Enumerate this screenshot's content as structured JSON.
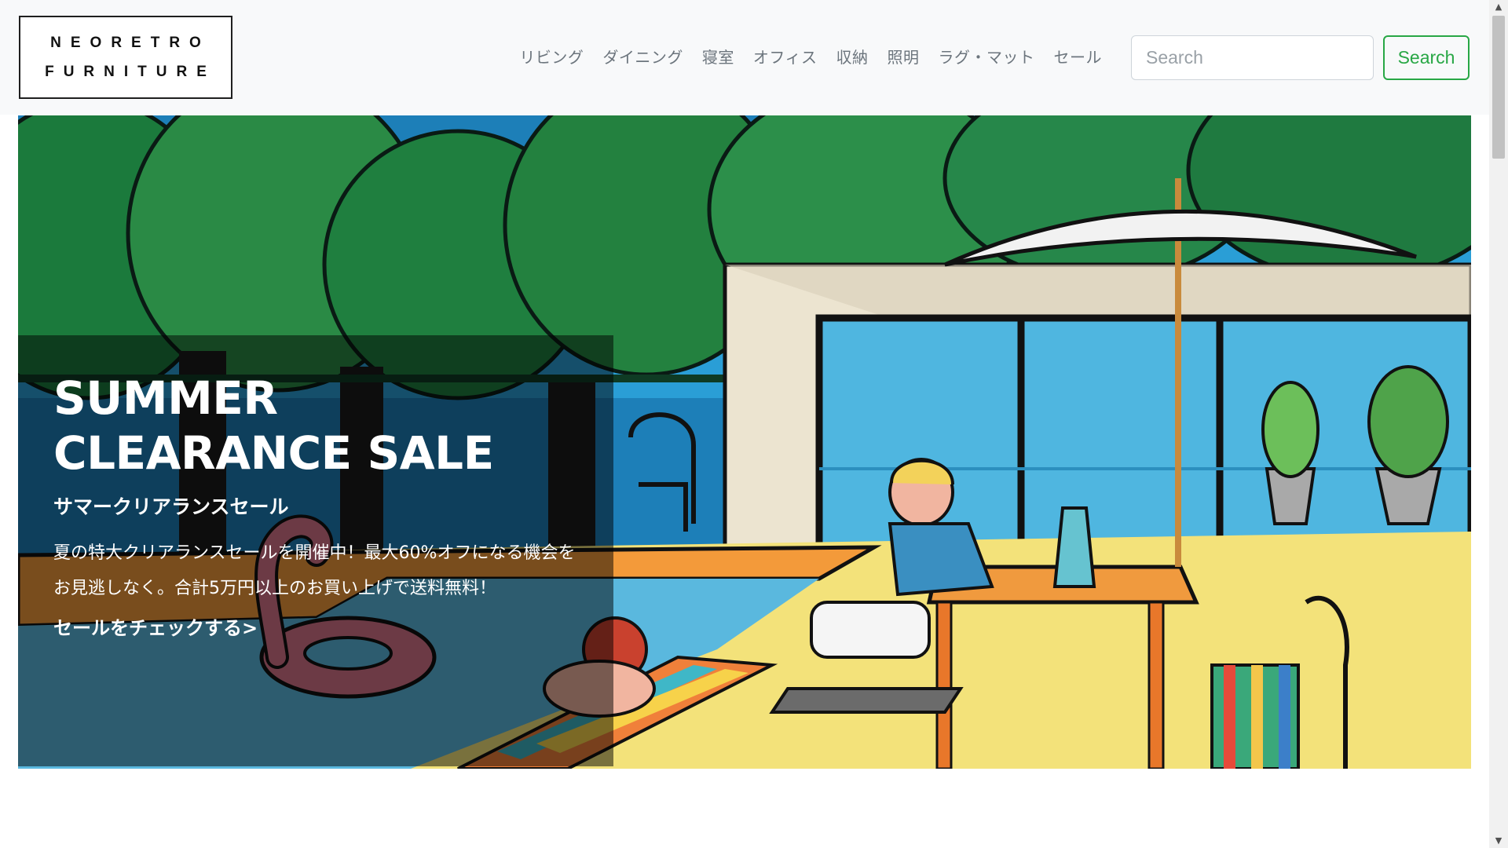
{
  "brand": {
    "logo_line1": "NEORETRO",
    "logo_line2": "FURNITURE"
  },
  "nav": {
    "items": [
      {
        "label": "リビング"
      },
      {
        "label": "ダイニング"
      },
      {
        "label": "寝室"
      },
      {
        "label": "オフィス"
      },
      {
        "label": "収納"
      },
      {
        "label": "照明"
      },
      {
        "label": "ラグ・マット"
      },
      {
        "label": "セール"
      }
    ]
  },
  "search": {
    "placeholder": "Search",
    "value": "",
    "button_label": "Search"
  },
  "hero": {
    "title": "SUMMER CLEARANCE SALE",
    "subtitle": "サマークリアランスセール",
    "text": "夏の特大クリアランスセールを開催中！最大60%オフになる機会をお見逃しなく。合計5万円以上のお買い上げで送料無料！",
    "link_label": "セールをチェックする>"
  },
  "colors": {
    "accent_green": "#28a745",
    "nav_text": "#6c757d",
    "navbar_bg": "#f8f9fa"
  },
  "icons": {
    "scroll_up": "scroll-up-arrow-icon",
    "scroll_down": "scroll-down-arrow-icon"
  }
}
